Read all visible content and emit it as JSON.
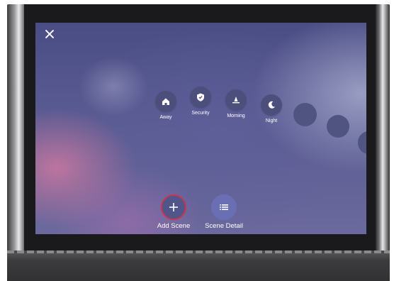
{
  "colors": {
    "screen_bg": "#5a5b92",
    "scene_circle": "#4c4f7c",
    "add_scene_ring": "#c8354f",
    "scene_detail_circle": "#6a6fb4",
    "text": "#ffffff"
  },
  "header": {
    "close_icon": "close-icon"
  },
  "scenes": [
    {
      "label": "Away",
      "icon": "home-icon"
    },
    {
      "label": "Security",
      "icon": "shield-icon"
    },
    {
      "label": "Morning",
      "icon": "sunrise-icon"
    },
    {
      "label": "Night",
      "icon": "moon-icon"
    }
  ],
  "actions": {
    "add_scene": {
      "label": "Add Scene",
      "icon": "plus-icon"
    },
    "scene_detail": {
      "label": "Scene Detail",
      "icon": "list-icon"
    }
  }
}
